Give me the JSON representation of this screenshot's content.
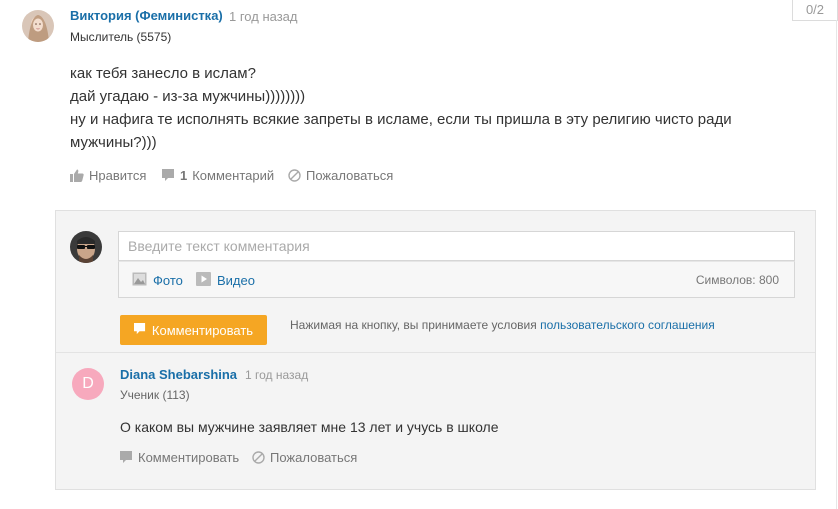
{
  "pager": {
    "counter": "0/2"
  },
  "post": {
    "author_name": "Виктория (Феминистка)",
    "time": "1 год назад",
    "rank": "Мыслитель (5575)",
    "lines": [
      "как тебя занесло в ислам?",
      "дай угадаю - из-за мужчины))))))))",
      "ну и нафига те исполнять всякие запреты в исламе, если ты пришла в эту религию чисто ради",
      "мужчины?)))"
    ],
    "actions": {
      "like": "Нравится",
      "comments_count": "1",
      "comments": "Комментарий",
      "report": "Пожаловаться"
    }
  },
  "comment_form": {
    "placeholder": "Введите текст комментария",
    "photo": "Фото",
    "video": "Видео",
    "chars_limit": "Символов: 800",
    "submit": "Комментировать",
    "terms_text": "Нажимая на кнопку, вы принимаете условия",
    "terms_link": "пользовательского соглашения"
  },
  "reply": {
    "avatar_letter": "D",
    "author_name": "Diana Shebarshina",
    "time": "1 год назад",
    "rank": "Ученик (113)",
    "text": "О каком вы мужчине заявляет мне 13 лет и учусь в школе",
    "actions": {
      "comment": "Комментировать",
      "report": "Пожаловаться"
    }
  },
  "colors": {
    "link": "#1a6fa8",
    "accent": "#f5a623",
    "avatar_reply": "#f7a9bd"
  },
  "icons": [
    "thumbs-up-icon",
    "comment-icon",
    "report-icon",
    "photo-icon",
    "video-icon"
  ]
}
